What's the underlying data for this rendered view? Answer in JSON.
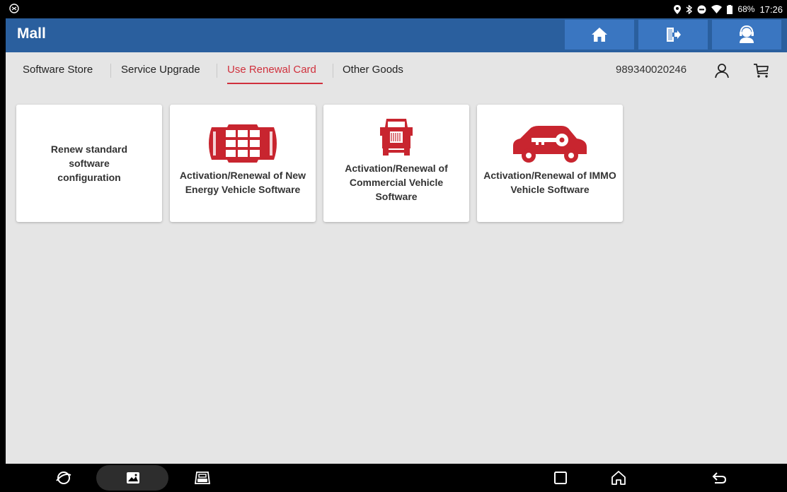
{
  "status_bar": {
    "battery": "68%",
    "time": "17:26"
  },
  "title_bar": {
    "title": "Mall",
    "buttons": [
      {
        "icon": "home-icon"
      },
      {
        "icon": "exit-icon"
      },
      {
        "icon": "support-agent-icon"
      }
    ]
  },
  "tabs": [
    {
      "label": "Software Store",
      "active": false
    },
    {
      "label": "Service Upgrade",
      "active": false
    },
    {
      "label": "Use Renewal Card",
      "active": true
    },
    {
      "label": "Other Goods",
      "active": false
    }
  ],
  "account": {
    "serial": "989340020246",
    "user_icon": "user-icon",
    "cart_icon": "cart-icon"
  },
  "cards": [
    {
      "label": "Renew standard software configuration",
      "icon": null
    },
    {
      "label": "Activation/Renewal of New Energy Vehicle Software",
      "icon": "battery-pack-icon"
    },
    {
      "label": "Activation/Renewal of Commercial Vehicle Software",
      "icon": "truck-icon"
    },
    {
      "label": "Activation/Renewal of IMMO Vehicle Software",
      "icon": "car-key-icon"
    }
  ],
  "nav_bar": {
    "items": [
      "browser-icon",
      "gallery-icon",
      "vci-icon",
      "recents-icon",
      "home-icon",
      "back-icon"
    ]
  },
  "colors": {
    "title_bar": "#2a5f9e",
    "title_button": "#3a76c1",
    "accent": "#d0313d",
    "background": "#e5e5e5"
  }
}
